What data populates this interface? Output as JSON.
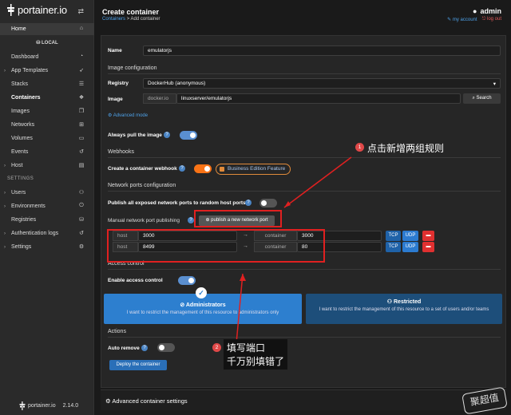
{
  "app": {
    "name": "portainer.io",
    "version": "2.14.0"
  },
  "sidebar": {
    "home": "Home",
    "env": "LOCAL",
    "items": [
      "Dashboard",
      "App Templates",
      "Stacks",
      "Containers",
      "Images",
      "Networks",
      "Volumes",
      "Events",
      "Host"
    ],
    "settings_section": "SETTINGS",
    "settings_items": [
      "Users",
      "Environments",
      "Registries",
      "Authentication logs",
      "Settings"
    ]
  },
  "header": {
    "title": "Create container",
    "crumb_link": "Containers",
    "crumb_rest": " > Add container",
    "user": "admin",
    "my_account": "my account",
    "logout": "log out"
  },
  "form": {
    "name_label": "Name",
    "name_value": "emulatorjs",
    "image_section": "Image configuration",
    "registry_label": "Registry",
    "registry_value": "DockerHub (anonymous)",
    "image_label": "Image",
    "image_prefix": "docker.io",
    "image_value": "linuxserver/emulatorjs",
    "search": "Search",
    "advanced_mode": "Advanced mode",
    "always_pull": "Always pull the image",
    "webhooks_section": "Webhooks",
    "webhook_label": "Create a container webhook",
    "business": "Business Edition Feature",
    "ports_section": "Network ports configuration",
    "publish_all": "Publish all exposed network ports to random host ports",
    "manual_label": "Manual network port publishing",
    "publish_new": "publish a new network port",
    "host_label": "host",
    "container_label": "container",
    "tcp": "TCP",
    "udp": "UDP",
    "ports": [
      {
        "host": "3000",
        "container": "3000"
      },
      {
        "host": "8499",
        "container": "80"
      }
    ],
    "access_section": "Access control",
    "enable_access": "Enable access control",
    "admins_title": "Administrators",
    "admins_desc": "I want to restrict the management of this resource to administrators only",
    "restricted_title": "Restricted",
    "restricted_desc": "I want to restrict the management of this resource to a set of users and/or teams",
    "actions_section": "Actions",
    "auto_remove": "Auto remove",
    "deploy": "Deploy the container",
    "advanced_settings": "Advanced container settings"
  },
  "annotations": {
    "one": "1",
    "one_text": "点击新增两组规则",
    "two": "2",
    "two_line1": "填写端口",
    "two_line2": "千万别填错了"
  },
  "watermark": "聚超值",
  "colors": {
    "accent": "#1f62a8",
    "orange": "#f97316",
    "red": "#e03030"
  }
}
